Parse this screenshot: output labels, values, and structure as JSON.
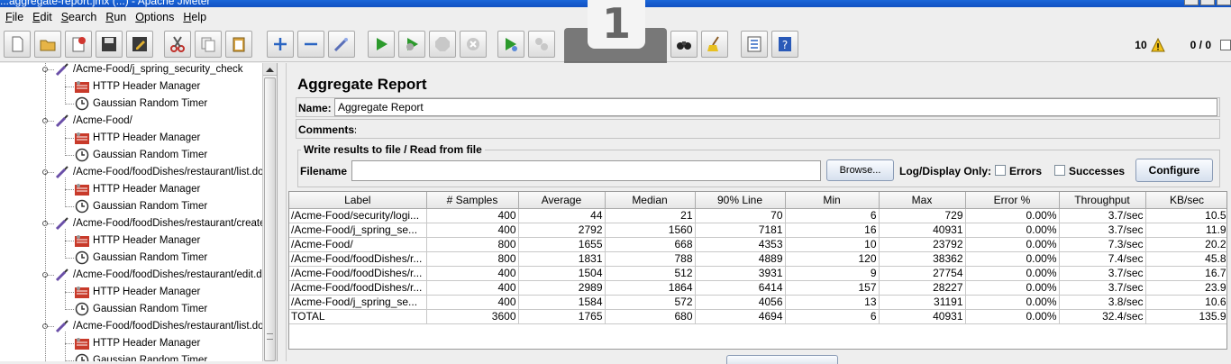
{
  "window": {
    "title": "...aggregate-report.jmx (...) - Apache JMeter"
  },
  "menu": [
    {
      "label": "File",
      "mnemonic": "F",
      "rest": "ile"
    },
    {
      "label": "Edit",
      "mnemonic": "E",
      "rest": "dit"
    },
    {
      "label": "Search",
      "mnemonic": "S",
      "rest": "earch"
    },
    {
      "label": "Run",
      "mnemonic": "R",
      "rest": "un"
    },
    {
      "label": "Options",
      "mnemonic": "O",
      "rest": "ptions"
    },
    {
      "label": "Help",
      "mnemonic": "H",
      "rest": "elp"
    }
  ],
  "overlay": {
    "number": "1"
  },
  "status": {
    "warnings": "10",
    "threads": "0 / 0"
  },
  "tree": [
    {
      "kind": "sampler",
      "label": "/Acme-Food/j_spring_security_check"
    },
    {
      "kind": "header",
      "label": "HTTP Header Manager"
    },
    {
      "kind": "timer",
      "label": "Gaussian Random Timer"
    },
    {
      "kind": "sampler",
      "label": "/Acme-Food/"
    },
    {
      "kind": "header",
      "label": "HTTP Header Manager"
    },
    {
      "kind": "timer",
      "label": "Gaussian Random Timer"
    },
    {
      "kind": "sampler",
      "label": "/Acme-Food/foodDishes/restaurant/list.do"
    },
    {
      "kind": "header",
      "label": "HTTP Header Manager"
    },
    {
      "kind": "timer",
      "label": "Gaussian Random Timer"
    },
    {
      "kind": "sampler",
      "label": "/Acme-Food/foodDishes/restaurant/create..."
    },
    {
      "kind": "header",
      "label": "HTTP Header Manager"
    },
    {
      "kind": "timer",
      "label": "Gaussian Random Timer"
    },
    {
      "kind": "sampler",
      "label": "/Acme-Food/foodDishes/restaurant/edit.do"
    },
    {
      "kind": "header",
      "label": "HTTP Header Manager"
    },
    {
      "kind": "timer",
      "label": "Gaussian Random Timer"
    },
    {
      "kind": "sampler",
      "label": "/Acme-Food/foodDishes/restaurant/list.do"
    },
    {
      "kind": "header",
      "label": "HTTP Header Manager"
    },
    {
      "kind": "timer",
      "label": "Gaussian Random Timer"
    }
  ],
  "report": {
    "title": "Aggregate Report",
    "name_label": "Name:",
    "name_value": "Aggregate Report",
    "comments_label": "Comments:",
    "write_legend": "Write results to file / Read from file",
    "filename_label": "Filename",
    "filename_value": "",
    "browse_label": "Browse...",
    "log_display_label": "Log/Display Only:",
    "errors_label": "Errors",
    "successes_label": "Successes",
    "configure_label": "Configure"
  },
  "table": {
    "columns": [
      "Label",
      "# Samples",
      "Average",
      "Median",
      "90% Line",
      "Min",
      "Max",
      "Error %",
      "Throughput",
      "KB/sec"
    ],
    "rows": [
      [
        "/Acme-Food/security/logi...",
        "400",
        "44",
        "21",
        "70",
        "6",
        "729",
        "0.00%",
        "3.7/sec",
        "10.5"
      ],
      [
        "/Acme-Food/j_spring_se...",
        "400",
        "2792",
        "1560",
        "7181",
        "16",
        "40931",
        "0.00%",
        "3.7/sec",
        "11.9"
      ],
      [
        "/Acme-Food/",
        "800",
        "1655",
        "668",
        "4353",
        "10",
        "23792",
        "0.00%",
        "7.3/sec",
        "20.2"
      ],
      [
        "/Acme-Food/foodDishes/r...",
        "800",
        "1831",
        "788",
        "4889",
        "120",
        "38362",
        "0.00%",
        "7.4/sec",
        "45.8"
      ],
      [
        "/Acme-Food/foodDishes/r...",
        "400",
        "1504",
        "512",
        "3931",
        "9",
        "27754",
        "0.00%",
        "3.7/sec",
        "16.7"
      ],
      [
        "/Acme-Food/foodDishes/r...",
        "400",
        "2989",
        "1864",
        "6414",
        "157",
        "28227",
        "0.00%",
        "3.7/sec",
        "23.9"
      ],
      [
        "/Acme-Food/j_spring_se...",
        "400",
        "1584",
        "572",
        "4056",
        "13",
        "31191",
        "0.00%",
        "3.8/sec",
        "10.6"
      ],
      [
        "TOTAL",
        "3600",
        "1765",
        "680",
        "4694",
        "6",
        "40931",
        "0.00%",
        "32.4/sec",
        "135.9"
      ]
    ]
  }
}
